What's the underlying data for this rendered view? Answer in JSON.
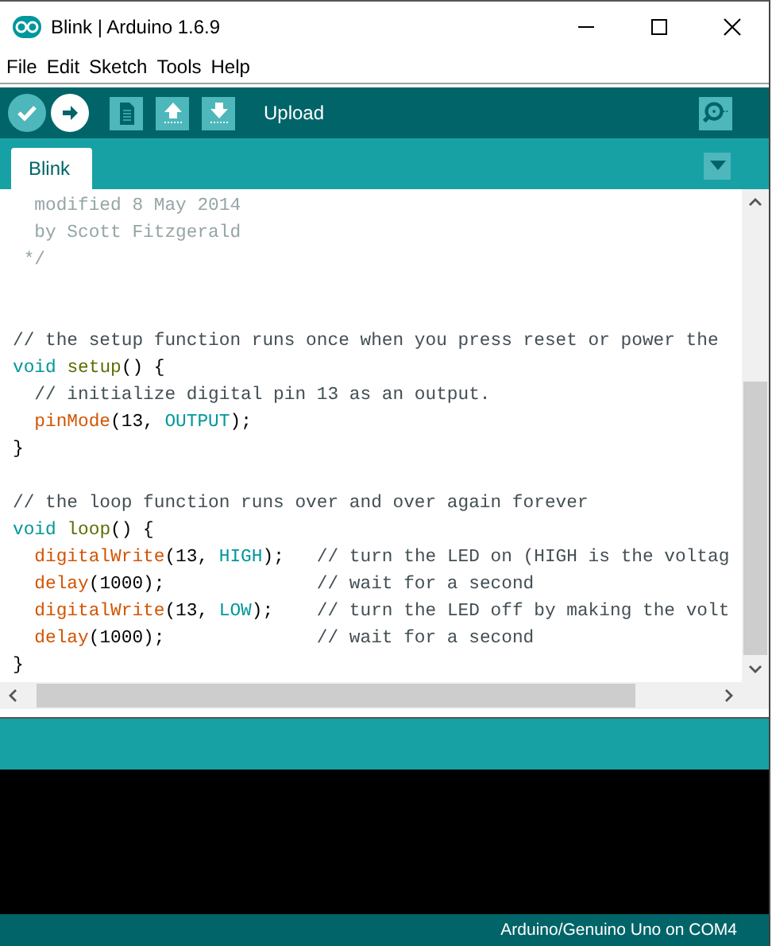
{
  "window": {
    "title": "Blink | Arduino 1.6.9"
  },
  "menu": [
    "File",
    "Edit",
    "Sketch",
    "Tools",
    "Help"
  ],
  "toolbar": {
    "buttons": [
      {
        "kind": "verify",
        "selected": false
      },
      {
        "kind": "upload",
        "selected": true
      },
      {
        "kind": "new",
        "selected": false
      },
      {
        "kind": "open",
        "selected": false
      },
      {
        "kind": "save",
        "selected": false
      }
    ],
    "hint": "Upload"
  },
  "tabs": [
    {
      "label": "Blink",
      "selected": true
    }
  ],
  "editor": {
    "lines": [
      {
        "kind": "code",
        "tokens": [
          {
            "kind": "doc",
            "text": "  modified 8 May 2014"
          }
        ]
      },
      {
        "kind": "code",
        "tokens": [
          {
            "kind": "doc",
            "text": "  by Scott Fitzgerald"
          }
        ]
      },
      {
        "kind": "code",
        "tokens": [
          {
            "kind": "doc",
            "text": " */"
          }
        ]
      },
      {
        "kind": "blank"
      },
      {
        "kind": "blank"
      },
      {
        "kind": "code",
        "tokens": [
          {
            "kind": "comment",
            "text": "// the setup function runs once when you press reset or power the"
          }
        ]
      },
      {
        "kind": "code",
        "tokens": [
          {
            "kind": "type",
            "text": "void "
          },
          {
            "kind": "name",
            "text": "setup"
          },
          {
            "kind": "plain",
            "text": "() {"
          }
        ]
      },
      {
        "kind": "code",
        "tokens": [
          {
            "kind": "comment",
            "text": "  // initialize digital pin 13 as an output."
          }
        ]
      },
      {
        "kind": "code",
        "tokens": [
          {
            "kind": "func",
            "text": "  pinMode"
          },
          {
            "kind": "plain",
            "text": "(13, "
          },
          {
            "kind": "const",
            "text": "OUTPUT"
          },
          {
            "kind": "plain",
            "text": ");"
          }
        ]
      },
      {
        "kind": "code",
        "tokens": [
          {
            "kind": "plain",
            "text": "}"
          }
        ]
      },
      {
        "kind": "blank"
      },
      {
        "kind": "code",
        "tokens": [
          {
            "kind": "comment",
            "text": "// the loop function runs over and over again forever"
          }
        ]
      },
      {
        "kind": "code",
        "tokens": [
          {
            "kind": "type",
            "text": "void "
          },
          {
            "kind": "name",
            "text": "loop"
          },
          {
            "kind": "plain",
            "text": "() {"
          }
        ]
      },
      {
        "kind": "code",
        "tokens": [
          {
            "kind": "func",
            "text": "  digitalWrite"
          },
          {
            "kind": "plain",
            "text": "(13, "
          },
          {
            "kind": "const",
            "text": "HIGH"
          },
          {
            "kind": "plain",
            "text": ");   "
          },
          {
            "kind": "comment",
            "text": "// turn the LED on (HIGH is the voltag"
          }
        ]
      },
      {
        "kind": "code",
        "tokens": [
          {
            "kind": "func",
            "text": "  delay"
          },
          {
            "kind": "plain",
            "text": "(1000);              "
          },
          {
            "kind": "comment",
            "text": "// wait for a second"
          }
        ]
      },
      {
        "kind": "code",
        "tokens": [
          {
            "kind": "func",
            "text": "  digitalWrite"
          },
          {
            "kind": "plain",
            "text": "(13, "
          },
          {
            "kind": "const",
            "text": "LOW"
          },
          {
            "kind": "plain",
            "text": ");    "
          },
          {
            "kind": "comment",
            "text": "// turn the LED off by making the volt"
          }
        ]
      },
      {
        "kind": "code",
        "tokens": [
          {
            "kind": "func",
            "text": "  delay"
          },
          {
            "kind": "plain",
            "text": "(1000);              "
          },
          {
            "kind": "comment",
            "text": "// wait for a second"
          }
        ]
      },
      {
        "kind": "code",
        "tokens": [
          {
            "kind": "plain",
            "text": "}"
          }
        ]
      }
    ]
  },
  "status_bar": {
    "board": "Arduino/Genuino Uno on COM4"
  }
}
